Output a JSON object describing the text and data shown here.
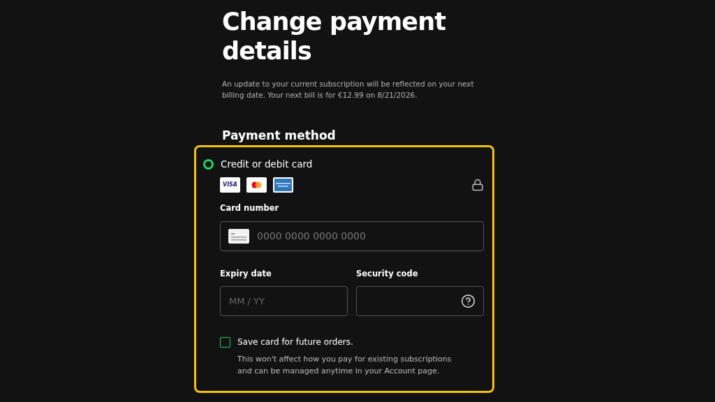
{
  "title": "Change payment details",
  "notice": "An update to your current subscription will be reflected on your next billing date. Your next bill is for €12.99 on 8/21/2026.",
  "section_heading": "Payment method",
  "payment_option": {
    "label": "Credit or debit card",
    "selected": true,
    "visa_logo": "VISA"
  },
  "card_number": {
    "label": "Card number",
    "placeholder": "0000 0000 0000 0000"
  },
  "expiry": {
    "label": "Expiry date",
    "placeholder": "MM / YY"
  },
  "security_code": {
    "label": "Security code"
  },
  "save_card": {
    "label": "Save card for future orders.",
    "checked": false,
    "note": "This won't affect how you pay for existing subscriptions and can be managed anytime in your Account page."
  }
}
